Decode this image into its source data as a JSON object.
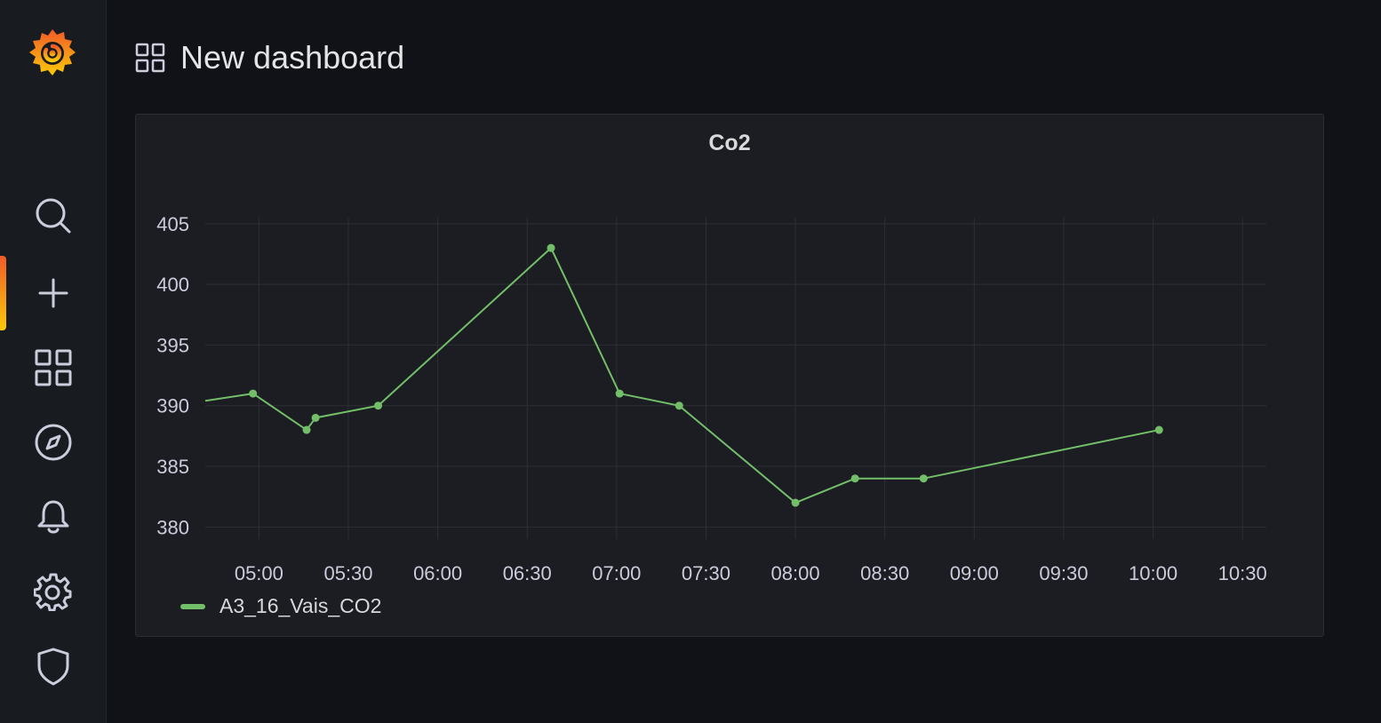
{
  "dashboard": {
    "title": "New dashboard"
  },
  "sidemenu": {
    "items": [
      {
        "name": "search",
        "icon": "search-icon"
      },
      {
        "name": "create",
        "icon": "plus-icon",
        "active": true
      },
      {
        "name": "dashboards",
        "icon": "apps-icon"
      },
      {
        "name": "explore",
        "icon": "compass-icon"
      },
      {
        "name": "alerting",
        "icon": "bell-icon"
      },
      {
        "name": "configuration",
        "icon": "gear-icon"
      },
      {
        "name": "server-admin",
        "icon": "shield-icon"
      }
    ],
    "accent_colors": [
      "#f05a28",
      "#fbca0a"
    ]
  },
  "panel": {
    "title": "Co2"
  },
  "chart_data": {
    "type": "line",
    "title": "Co2",
    "x_tick_labels": [
      "05:00",
      "05:30",
      "06:00",
      "06:30",
      "07:00",
      "07:30",
      "08:00",
      "08:30",
      "09:00",
      "09:30",
      "10:00",
      "10:30"
    ],
    "y_tick_labels": [
      "380",
      "385",
      "390",
      "395",
      "400",
      "405"
    ],
    "xlim": [
      "04:42",
      "10:38"
    ],
    "ylim": [
      379,
      405.5
    ],
    "grid": true,
    "legend_position": "bottom-left",
    "series": [
      {
        "name": "A3_16_Vais_CO2",
        "color": "#73bf69",
        "points": [
          {
            "x": "04:42",
            "y": 390.4
          },
          {
            "x": "04:58",
            "y": 391
          },
          {
            "x": "05:16",
            "y": 388
          },
          {
            "x": "05:19",
            "y": 389
          },
          {
            "x": "05:40",
            "y": 390
          },
          {
            "x": "06:38",
            "y": 403
          },
          {
            "x": "07:01",
            "y": 391
          },
          {
            "x": "07:21",
            "y": 390
          },
          {
            "x": "08:00",
            "y": 382
          },
          {
            "x": "08:20",
            "y": 384
          },
          {
            "x": "08:43",
            "y": 384
          },
          {
            "x": "10:02",
            "y": 388
          }
        ],
        "marker_points": [
          "04:58",
          "05:16",
          "05:19",
          "05:40",
          "06:38",
          "07:01",
          "07:21",
          "08:00",
          "08:20",
          "08:43",
          "10:02"
        ]
      }
    ]
  }
}
